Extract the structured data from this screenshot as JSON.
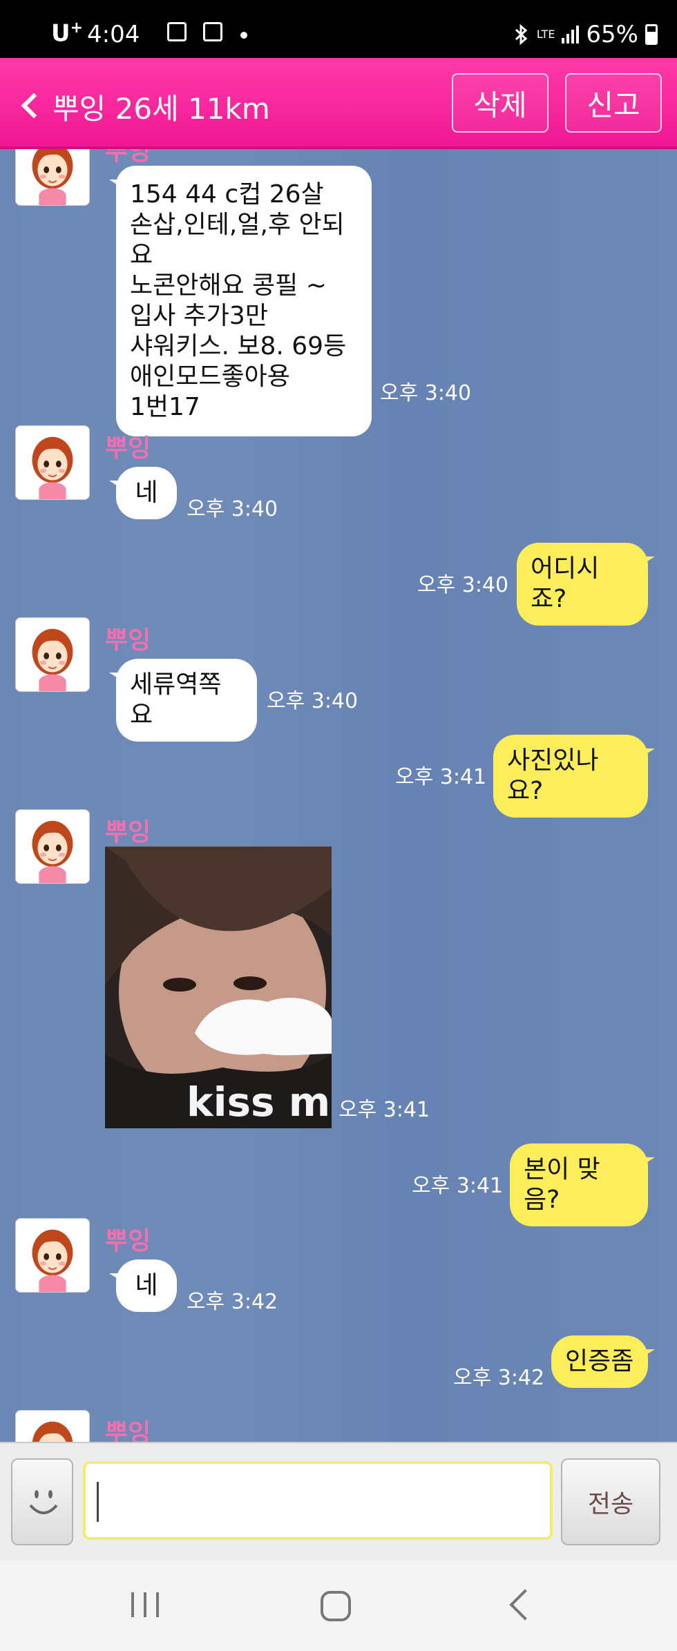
{
  "status_bar": {
    "carrier": "U",
    "carrier_sup": "+",
    "time": "4:04",
    "network": "LTE",
    "battery": "65%"
  },
  "header": {
    "title": "뿌잉 26세 11km",
    "delete_label": "삭제",
    "report_label": "신고"
  },
  "contact": {
    "name": "뿌잉"
  },
  "messages": [
    {
      "from": "them",
      "text": "154  44  c컵  26살\n손삽,인테,얼,후 안되요\n노콘안해요 콩필 ~\n입사  추가3만\n샤워키스. 보8. 69등\n애인모드좋아용\n1번17",
      "time": "오후 3:40"
    },
    {
      "from": "them",
      "name": "뿌잉",
      "text": "네",
      "time": "오후 3:40"
    },
    {
      "from": "me",
      "text": "어디시죠?",
      "time": "오후 3:40"
    },
    {
      "from": "them",
      "name": "뿌잉",
      "text": "세류역쪽요",
      "time": "오후 3:40"
    },
    {
      "from": "me",
      "text": "사진있나요?",
      "time": "오후 3:41"
    },
    {
      "from": "them",
      "name": "뿌잉",
      "image": "photo",
      "image_caption": "kiss m",
      "time": "오후 3:41"
    },
    {
      "from": "me",
      "text": "본이 맞음?",
      "time": "오후 3:41"
    },
    {
      "from": "them",
      "name": "뿌잉",
      "text": "네",
      "time": "오후 3:42"
    },
    {
      "from": "me",
      "text": "인증좀",
      "time": "오후 3:42"
    },
    {
      "from": "them",
      "name": "뿌잉"
    }
  ],
  "input": {
    "value": "",
    "send_label": "전송"
  },
  "colors": {
    "header": "#f01894",
    "chat_background": "#6b87b4",
    "outgoing_bubble": "#fbee5a",
    "incoming_bubble": "#ffffff",
    "name": "#f26fb0"
  },
  "icons": [
    "back-icon",
    "bluetooth-icon",
    "signal-icon",
    "battery-icon",
    "smiley-icon",
    "nav-recent-icon",
    "nav-home-icon",
    "nav-back-icon"
  ]
}
